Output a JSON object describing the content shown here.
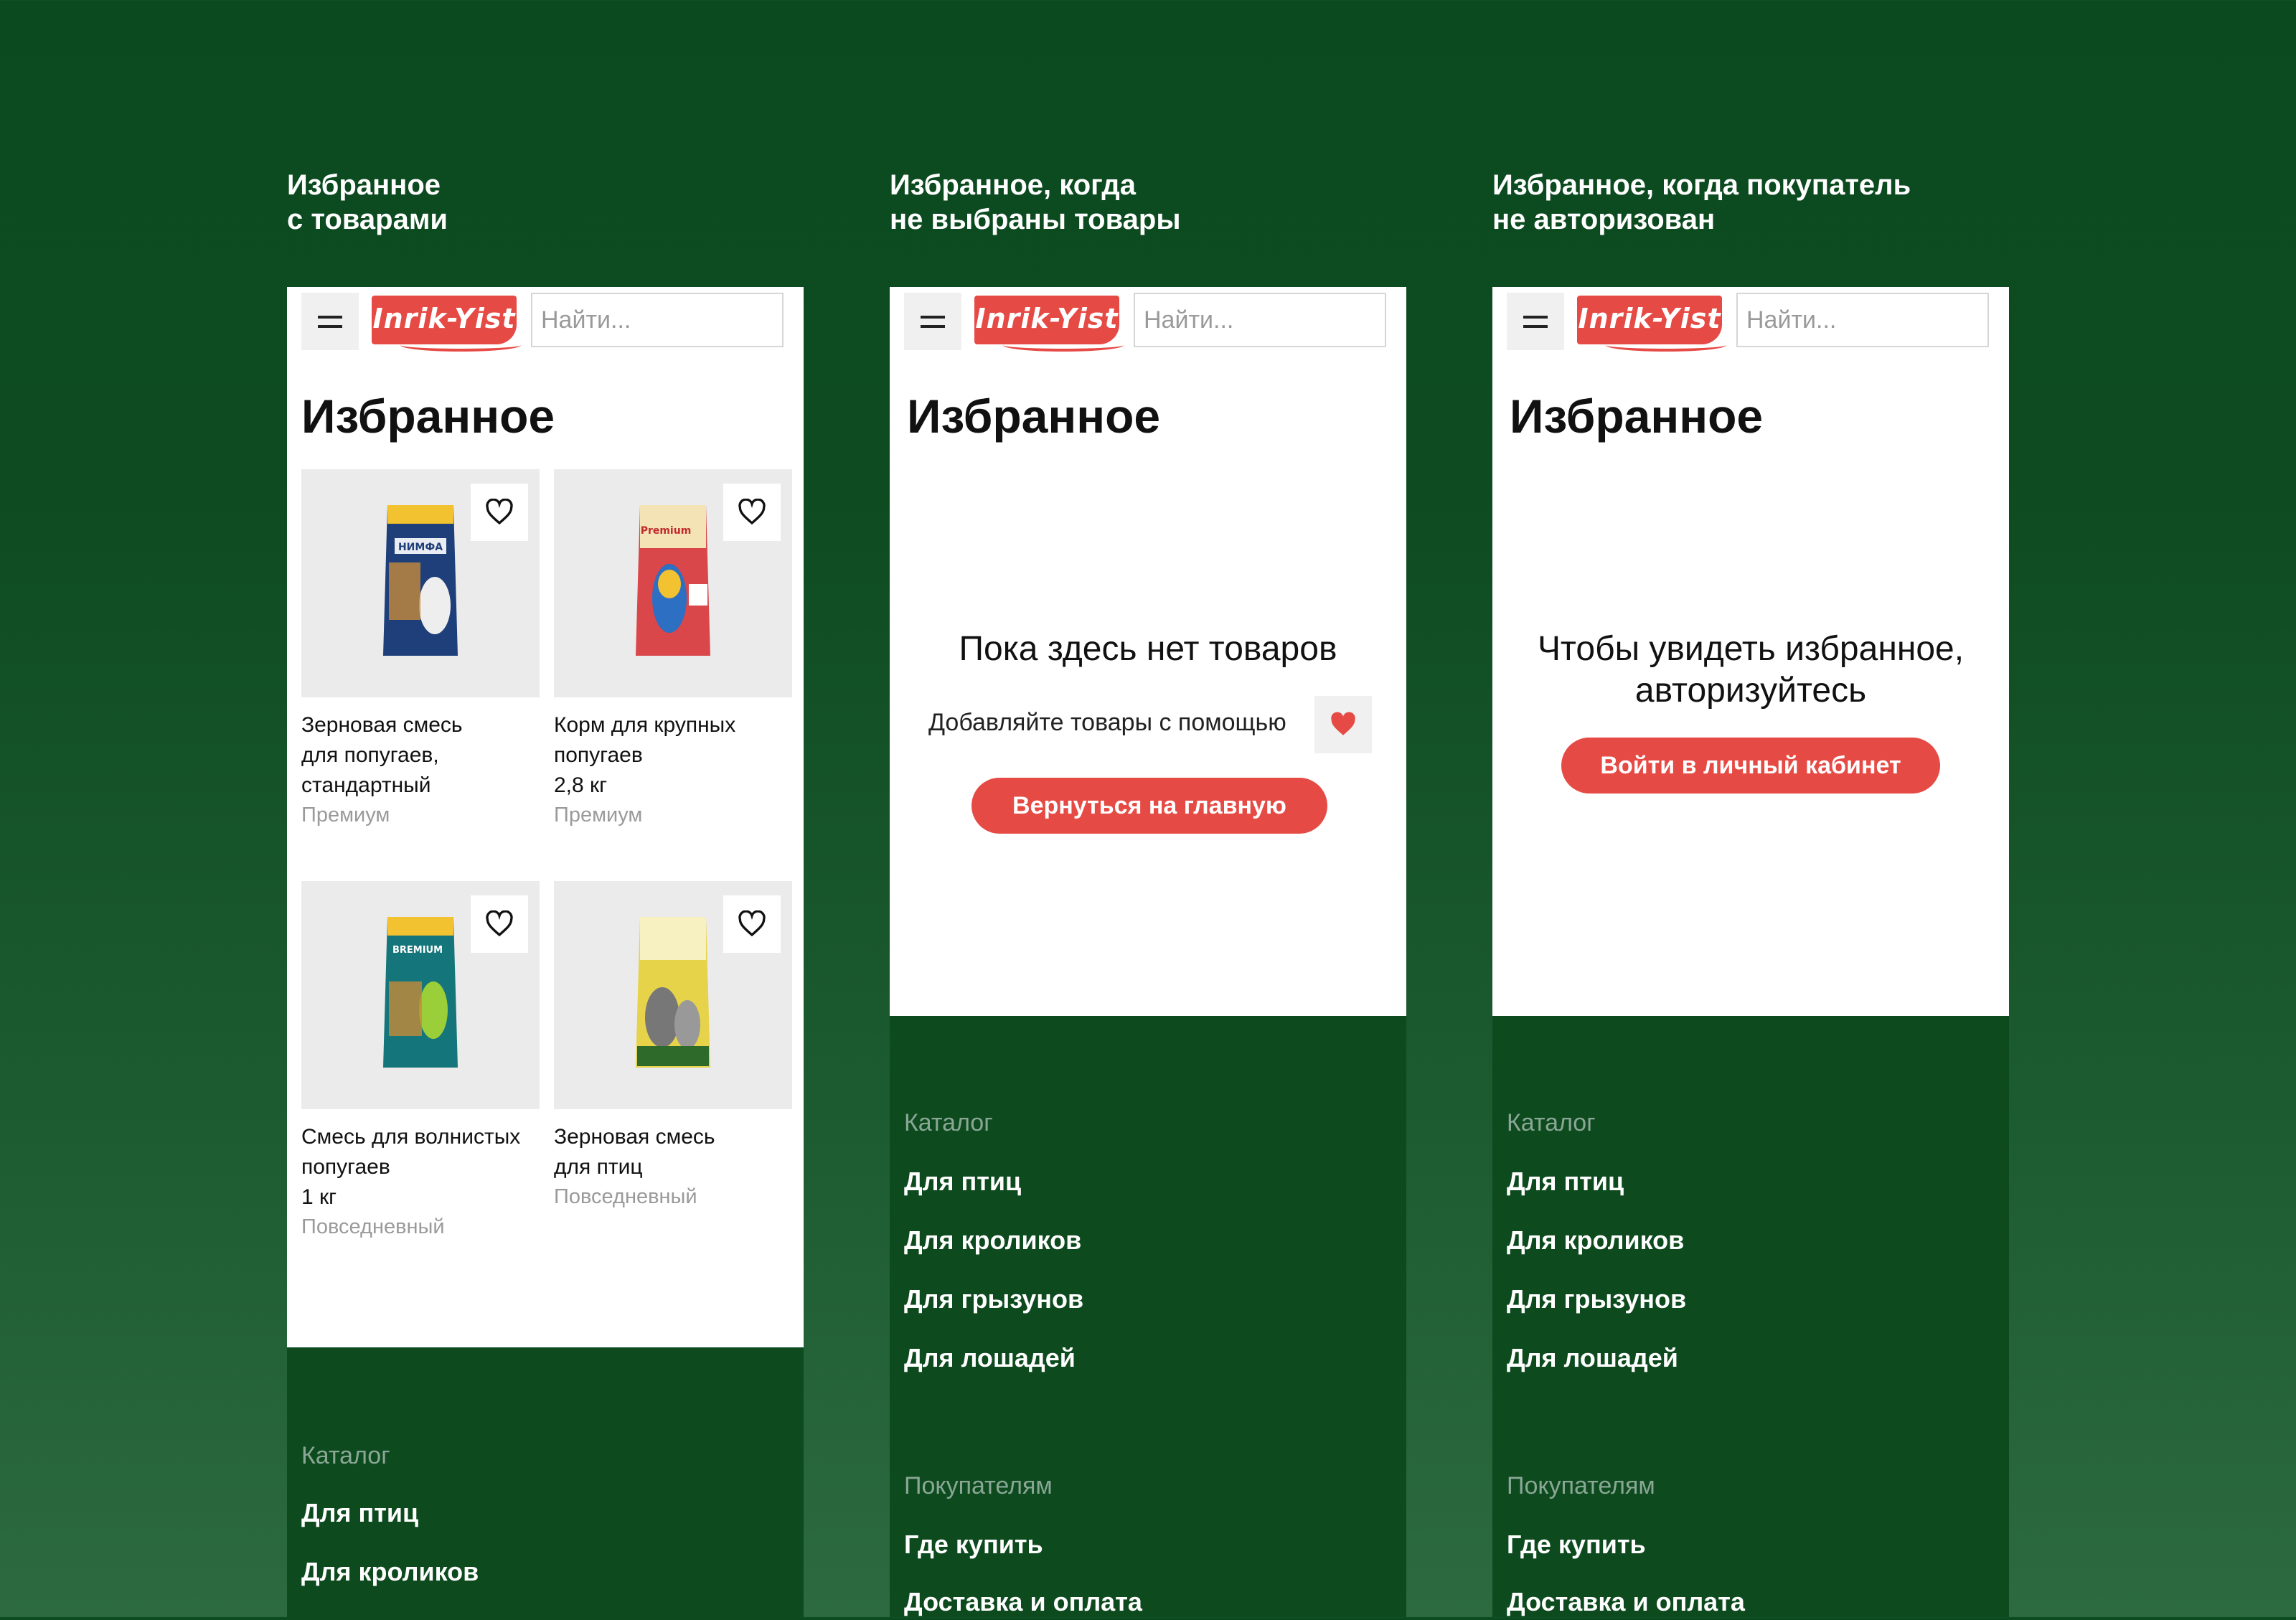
{
  "captions": {
    "c1": "Избранное\nс товарами",
    "c2": "Избранное, когда\nне выбраны товары",
    "c3": "Избранное, когда покупатель\nне авторизован"
  },
  "header": {
    "logo_text": "Inrik-Yist",
    "search_placeholder": "Найти..."
  },
  "page_title": "Избранное",
  "products": [
    {
      "name": "Зерновая смесь\nдля попугаев,\nстандартный",
      "tag": "Премиум",
      "pack_color": "#1e3f7a",
      "pack_label": "НИМФА"
    },
    {
      "name": "Корм для крупных\nпопугаев\n2,8 кг",
      "tag": "Премиум",
      "pack_color": "#d9474b",
      "pack_label": "Premium"
    },
    {
      "name": "Смесь для волнистых\nпопугаев\n1 кг",
      "tag": "Повседневный",
      "pack_color": "#14757a",
      "pack_label": "BREMIUM"
    },
    {
      "name": "Зерновая смесь\nдля птиц",
      "tag": "Повседневный",
      "pack_color": "#e6d34a",
      "pack_label": ""
    }
  ],
  "empty": {
    "title": "Пока здесь нет товаров",
    "hint": "Добавляйте товары с помощью",
    "button": "Вернуться на главную"
  },
  "auth": {
    "title_line1": "Чтобы увидеть избранное,",
    "title_line2": "авторизуйтесь",
    "button": "Войти в личный кабинет"
  },
  "footer": {
    "catalog_heading": "Каталог",
    "catalog_items": [
      "Для птиц",
      "Для кроликов",
      "Для грызунов",
      "Для лошадей"
    ],
    "buyers_heading": "Покупателям",
    "buyers_items": [
      "Где купить",
      "Доставка и оплата"
    ]
  },
  "colors": {
    "accent": "#e64a44",
    "footer_bg": "#0d4a1e",
    "thumb_bg": "#ebebeb"
  }
}
